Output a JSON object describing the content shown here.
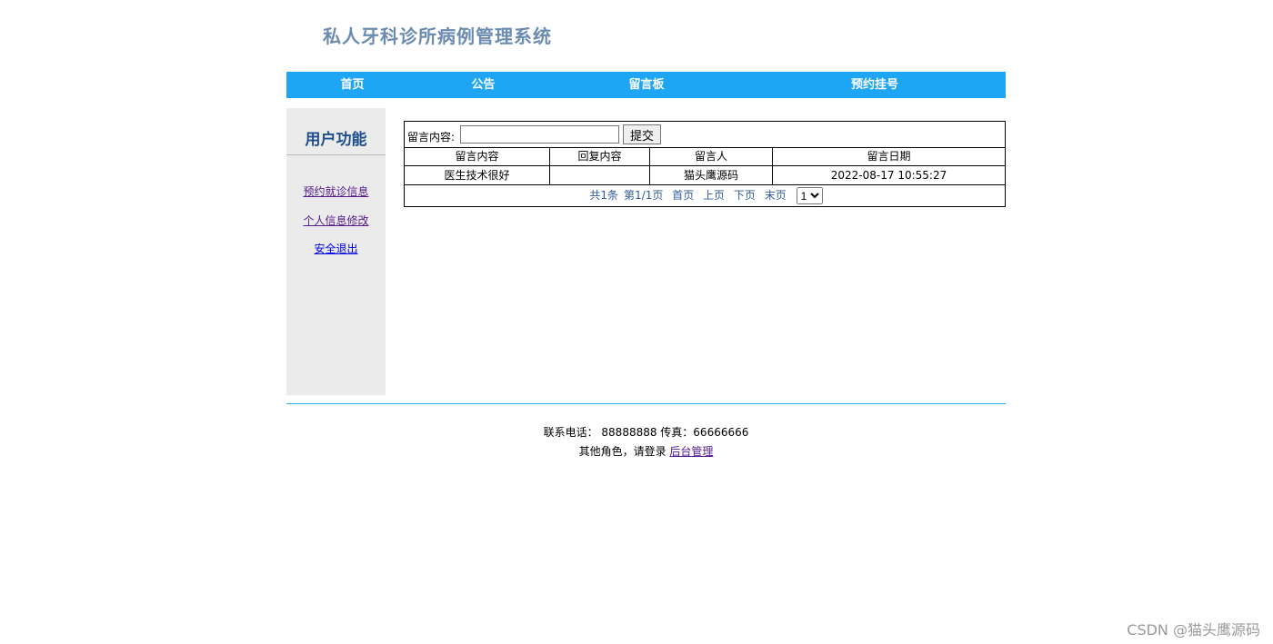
{
  "site": {
    "title": "私人牙科诊所病例管理系统"
  },
  "nav": {
    "items": [
      "首页",
      "公告",
      "留言板",
      "预约挂号"
    ]
  },
  "sidebar": {
    "title": "用户功能",
    "links": [
      "预约就诊信息",
      "个人信息修改",
      "安全退出"
    ]
  },
  "message_form": {
    "label": "留言内容:",
    "value": "",
    "submit_label": "提交"
  },
  "message_table": {
    "headers": [
      "留言内容",
      "回复内容",
      "留言人",
      "留言日期"
    ],
    "rows": [
      [
        "医生技术很好",
        "",
        "猫头鹰源码",
        "2022-08-17 10:55:27"
      ]
    ]
  },
  "pager": {
    "total": "共1条",
    "page_info": "第1/1页",
    "first": "首页",
    "prev": "上页",
    "next": "下页",
    "last": "末页",
    "selected_page": "1"
  },
  "footer": {
    "contact": "联系电话： 88888888 传真：66666666",
    "login_prompt": "其他角色，请登录",
    "admin_link": "后台管理"
  },
  "watermark": "CSDN @猫头鹰源码",
  "colors": {
    "nav_bg": "#1ea6f5",
    "title": "#6b8bb0",
    "sidebar_bg": "#ebebeb",
    "footer_rule": "#26b5d8"
  }
}
